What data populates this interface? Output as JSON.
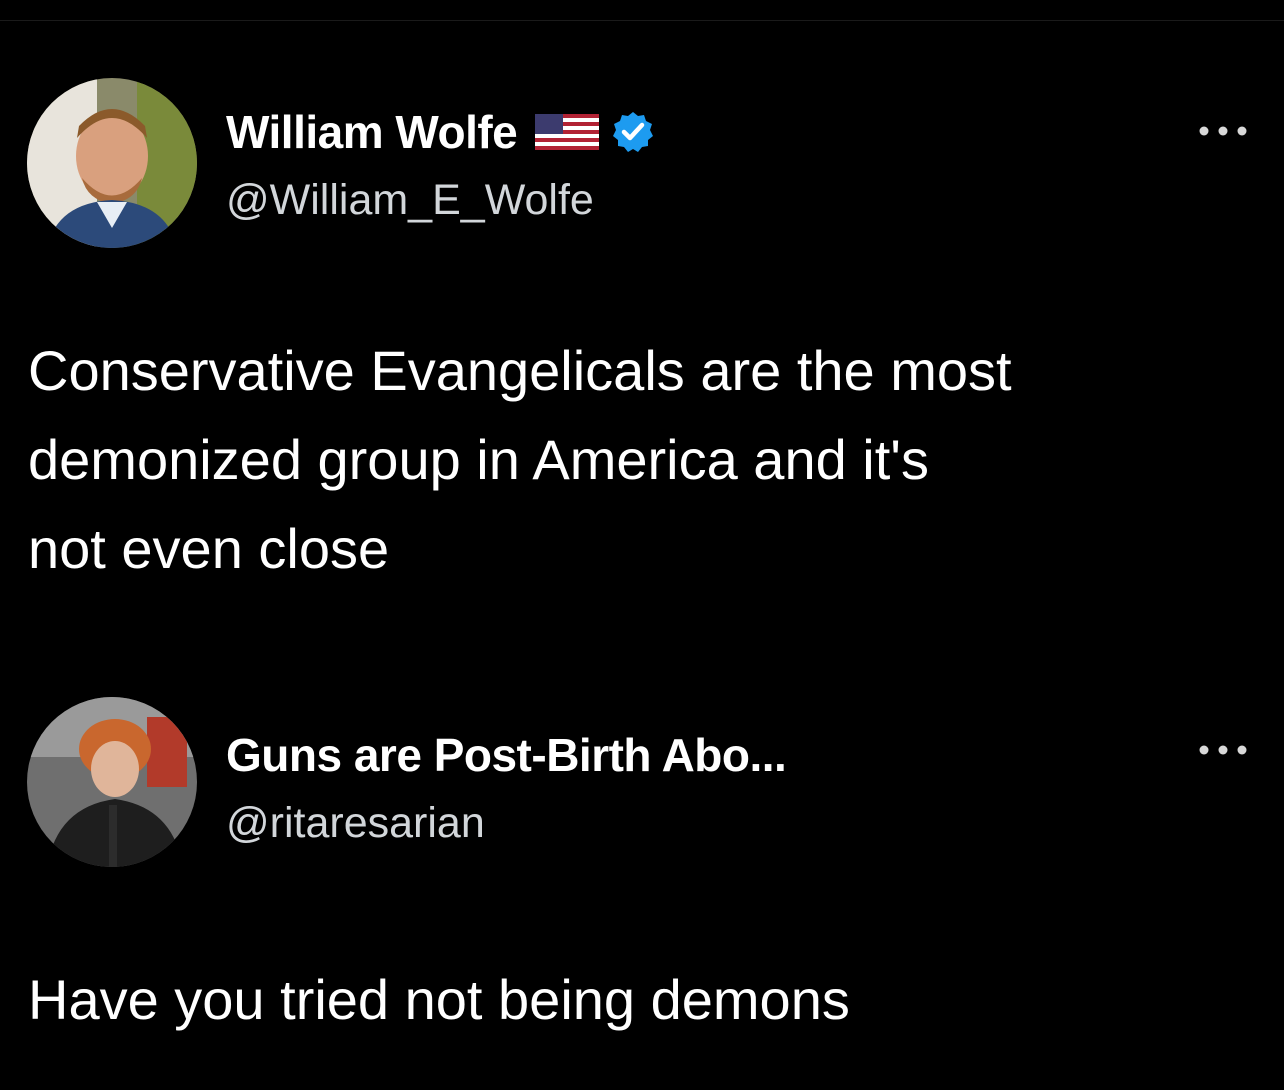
{
  "tweets": [
    {
      "display_name": "William Wolfe",
      "handle": "@William_E_Wolfe",
      "badges": [
        "us-flag-icon",
        "verified-icon"
      ],
      "text": "Conservative Evangelicals are the most\ndemonized group in America and it's\nnot even close",
      "avatar_icon": "avatar-photo"
    },
    {
      "display_name": "Guns are Post-Birth Abo...",
      "handle": "@ritaresarian",
      "badges": [],
      "text": "Have you tried not being demons",
      "avatar_icon": "avatar-photo"
    }
  ],
  "colors": {
    "background": "#000000",
    "text": "#ffffff",
    "handle": "#d2d6da",
    "verified": "#1d9bf0"
  }
}
